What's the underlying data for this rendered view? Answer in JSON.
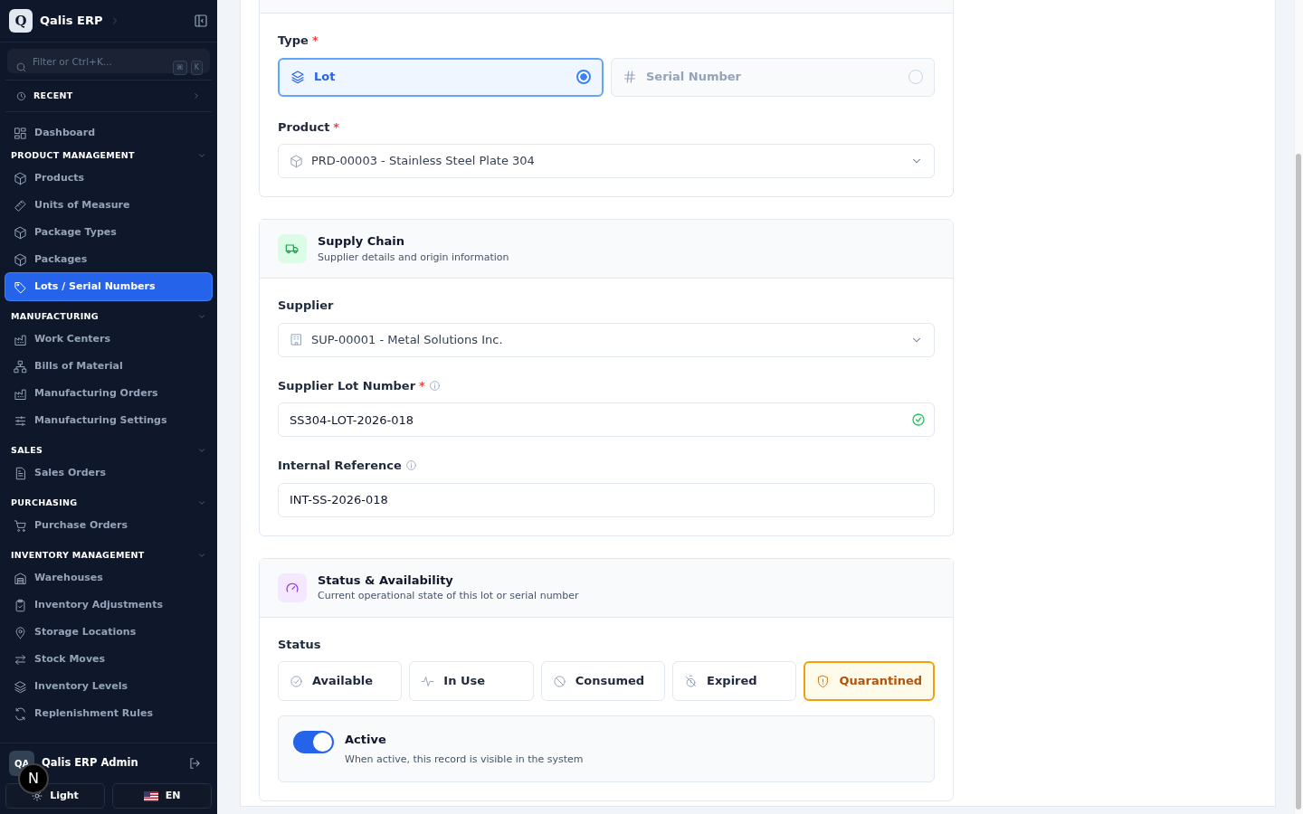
{
  "sidebar": {
    "brand": "Qalis ERP",
    "logo_letter": "Q",
    "search_placeholder": "Filter or Ctrl+K...",
    "shortcut_keys": [
      "⌘",
      "K"
    ],
    "recent": "RECENT",
    "groups": [
      {
        "items": [
          {
            "label": "Dashboard",
            "selected": false
          }
        ]
      },
      {
        "title": "PRODUCT MANAGEMENT",
        "expanded": true,
        "items": [
          {
            "label": "Products",
            "selected": false
          },
          {
            "label": "Units of Measure",
            "selected": false
          },
          {
            "label": "Package Types",
            "selected": false
          },
          {
            "label": "Packages",
            "selected": false
          },
          {
            "label": "Lots / Serial Numbers",
            "selected": true
          }
        ]
      },
      {
        "title": "MANUFACTURING",
        "expanded": true,
        "items": [
          {
            "label": "Work Centers",
            "selected": false
          },
          {
            "label": "Bills of Material",
            "selected": false
          },
          {
            "label": "Manufacturing Orders",
            "selected": false
          },
          {
            "label": "Manufacturing Settings",
            "selected": false
          }
        ]
      },
      {
        "title": "SALES",
        "expanded": true,
        "items": [
          {
            "label": "Sales Orders",
            "selected": false
          }
        ]
      },
      {
        "title": "PURCHASING",
        "expanded": true,
        "items": [
          {
            "label": "Purchase Orders",
            "selected": false
          }
        ]
      },
      {
        "title": "INVENTORY MANAGEMENT",
        "expanded": true,
        "items": [
          {
            "label": "Warehouses",
            "selected": false
          },
          {
            "label": "Inventory Adjustments",
            "selected": false
          },
          {
            "label": "Storage Locations",
            "selected": false
          },
          {
            "label": "Stock Moves",
            "selected": false
          },
          {
            "label": "Inventory Levels",
            "selected": false
          },
          {
            "label": "Replenishment Rules",
            "selected": false
          }
        ]
      }
    ],
    "user": {
      "initials": "QA",
      "name": "Qalis ERP Admin"
    },
    "theme_button": "Light",
    "language_button": "EN",
    "dev_badge": "N"
  },
  "form": {
    "type": {
      "label": "Type",
      "required_mark": "*",
      "options": [
        {
          "label": "Lot",
          "selected": true
        },
        {
          "label": "Serial Number",
          "selected": false
        }
      ]
    },
    "product": {
      "label": "Product",
      "required_mark": "*",
      "value": "PRD-00003 - Stainless Steel Plate 304"
    },
    "supply_chain": {
      "title": "Supply Chain",
      "subtitle": "Supplier details and origin information",
      "supplier": {
        "label": "Supplier",
        "value": "SUP-00001 - Metal Solutions Inc."
      },
      "supplier_lot": {
        "label": "Supplier Lot Number",
        "required_mark": "*",
        "value": "SS304-LOT-2026-018",
        "valid": true
      },
      "internal_reference": {
        "label": "Internal Reference",
        "value": "INT-SS-2026-018"
      }
    },
    "status_section": {
      "title": "Status & Availability",
      "subtitle": "Current operational state of this lot or serial number",
      "status_label": "Status",
      "statuses": [
        {
          "label": "Available",
          "selected": false
        },
        {
          "label": "In Use",
          "selected": false
        },
        {
          "label": "Consumed",
          "selected": false
        },
        {
          "label": "Expired",
          "selected": false
        },
        {
          "label": "Quarantined",
          "selected": true
        }
      ],
      "active": {
        "label": "Active",
        "description": "When active, this record is visible in the system",
        "on": true
      }
    }
  }
}
